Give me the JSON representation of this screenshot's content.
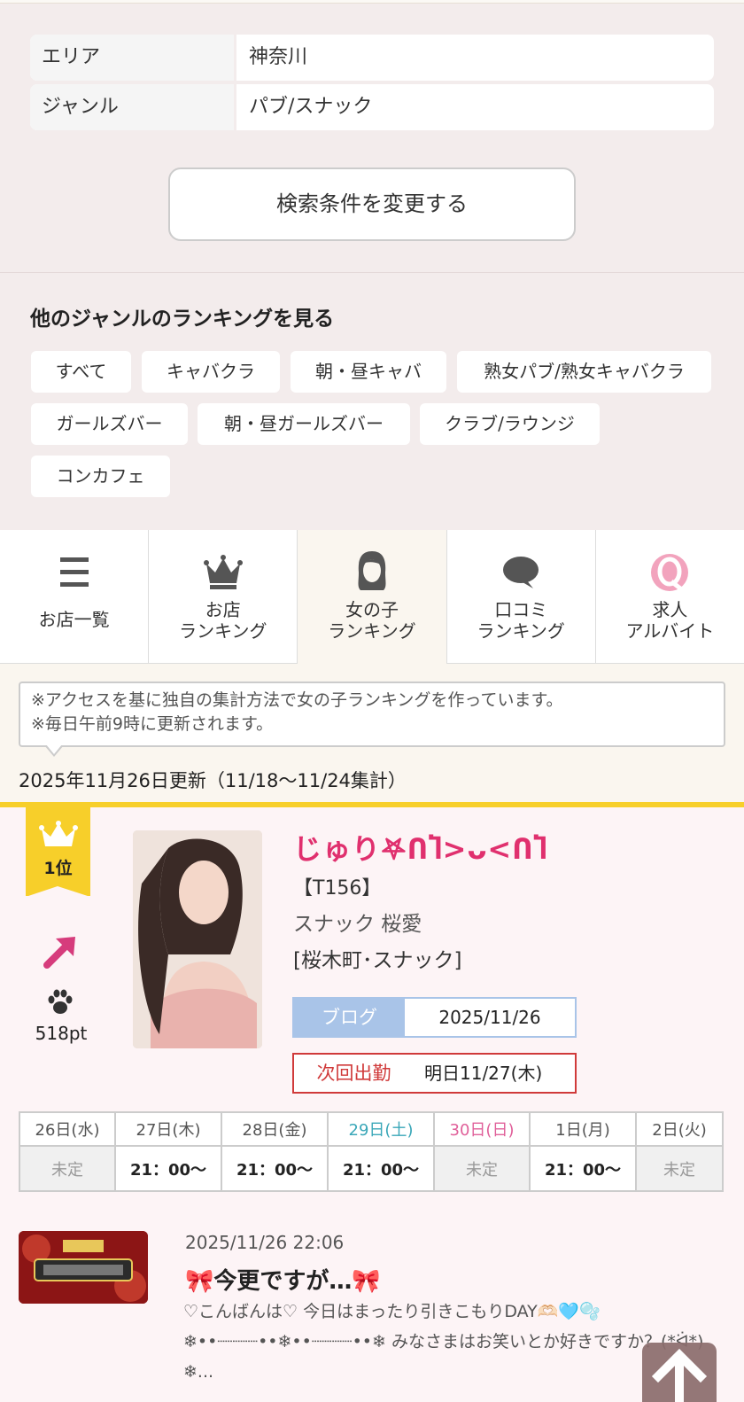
{
  "criteria": [
    {
      "key": "エリア",
      "value": "神奈川"
    },
    {
      "key": "ジャンル",
      "value": "パブ/スナック"
    }
  ],
  "change_button": "検索条件を変更する",
  "genre_section": {
    "title": "他のジャンルのランキングを見る",
    "chips": [
      "すべて",
      "キャバクラ",
      "朝・昼キャバ",
      "熟女パブ/熟女キャバクラ",
      "ガールズバー",
      "朝・昼ガールズバー",
      "クラブ/ラウンジ",
      "コンカフェ"
    ]
  },
  "tabs": [
    {
      "line1": "お店一覧",
      "line2": "",
      "icon": "menu-icon",
      "active": false
    },
    {
      "line1": "お店",
      "line2": "ランキング",
      "icon": "crown-icon",
      "active": false
    },
    {
      "line1": "女の子",
      "line2": "ランキング",
      "icon": "girl-icon",
      "active": true
    },
    {
      "line1": "口コミ",
      "line2": "ランキング",
      "icon": "speech-bubble-icon",
      "active": false
    },
    {
      "line1": "求人",
      "line2": "アルバイト",
      "icon": "q-job-icon",
      "active": false
    }
  ],
  "note": {
    "line1": "※アクセスを基に独自の集計方法で女の子ランキングを作っています。",
    "line2": "※毎日午前9時に更新されます。"
  },
  "updated": "2025年11月26日更新（11/18〜11/24集計）",
  "entry": {
    "rank": "1位",
    "trend": "up",
    "points": "518pt",
    "name": "じゅり𖤐ՈႨ>ᴗ<ՈႨ",
    "tag": "【T156】",
    "shop": "スナック 桜愛",
    "area": "[桜木町･スナック]",
    "blog_label": "ブログ",
    "blog_date": "2025/11/26",
    "next_label": "次回出勤",
    "next_value": "明日11/27(木)"
  },
  "schedule": {
    "days": [
      {
        "day": "26日(水)",
        "time": "未定",
        "type": "weekday"
      },
      {
        "day": "27日(木)",
        "time": "21：00〜",
        "type": "weekday"
      },
      {
        "day": "28日(金)",
        "time": "21：00〜",
        "type": "weekday"
      },
      {
        "day": "29日(土)",
        "time": "21：00〜",
        "type": "sat"
      },
      {
        "day": "30日(日)",
        "time": "未定",
        "type": "sun"
      },
      {
        "day": "1日(月)",
        "time": "21：00〜",
        "type": "weekday"
      },
      {
        "day": "2日(火)",
        "time": "未定",
        "type": "weekday"
      }
    ]
  },
  "blog_post": {
    "date": "2025/11/26 22:06",
    "title": "🎀今更ですが…🎀",
    "excerpt": "♡こんばんは♡ 今日はまったり引きこもりDAY🫶🏻🩵🫧 ❄︎••┈┈┈┈••❄︎••┈┈┈┈••❄︎ みなさまはお笑いとか好きですか？(*ᐛ*) ❄︎..."
  },
  "colors": {
    "accent_pink": "#e0306e",
    "gold": "#f7cf2a",
    "blog_blue": "#a9c4e8",
    "next_red": "#d03a3a"
  }
}
